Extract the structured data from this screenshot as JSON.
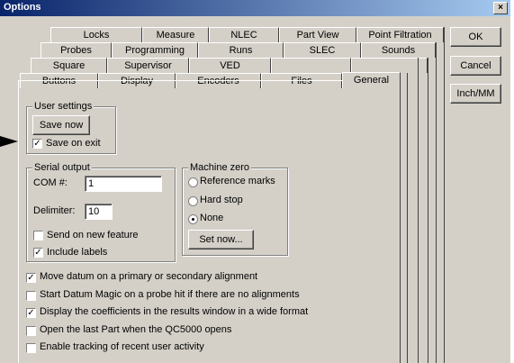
{
  "window": {
    "title": "Options",
    "close_glyph": "×"
  },
  "tabs": {
    "row1": [
      "Locks",
      "Measure",
      "NLEC",
      "Part View",
      "Point Filtration"
    ],
    "row2": [
      "Probes",
      "Programming",
      "Runs",
      "SLEC",
      "Sounds"
    ],
    "row3": [
      "Square",
      "Supervisor",
      "VED",
      "",
      ""
    ],
    "row4": [
      "Buttons",
      "Display",
      "Encoders",
      "Files",
      "General"
    ]
  },
  "side_buttons": {
    "ok": "OK",
    "cancel": "Cancel",
    "inch_mm": "Inch/MM"
  },
  "user_settings": {
    "label": "User settings",
    "save_now": "Save now",
    "save_on_exit": "Save on exit",
    "save_on_exit_checked": true
  },
  "serial_output": {
    "label": "Serial output",
    "com_label": "COM #:",
    "com_value": "1",
    "delimiter_label": "Delimiter:",
    "delimiter_value": "10",
    "send_on_new_feature": "Send on new feature",
    "send_checked": false,
    "include_labels": "Include labels",
    "include_checked": true
  },
  "machine_zero": {
    "label": "Machine zero",
    "options": [
      "Reference marks",
      "Hard stop",
      "None"
    ],
    "selected": "None",
    "set_now": "Set now..."
  },
  "general_options": [
    {
      "text": "Move datum on a primary or secondary alignment",
      "checked": true
    },
    {
      "text": "Start Datum Magic on a probe hit if there are no alignments",
      "checked": false
    },
    {
      "text": "Display the coefficients in the results window in a wide format",
      "checked": true
    },
    {
      "text": "Open the last Part when the QC5000 opens",
      "checked": false
    },
    {
      "text": "Enable tracking of recent user activity",
      "checked": false
    }
  ],
  "check_glyph": "✓",
  "pointer_icon": "arrow-pointer-icon"
}
